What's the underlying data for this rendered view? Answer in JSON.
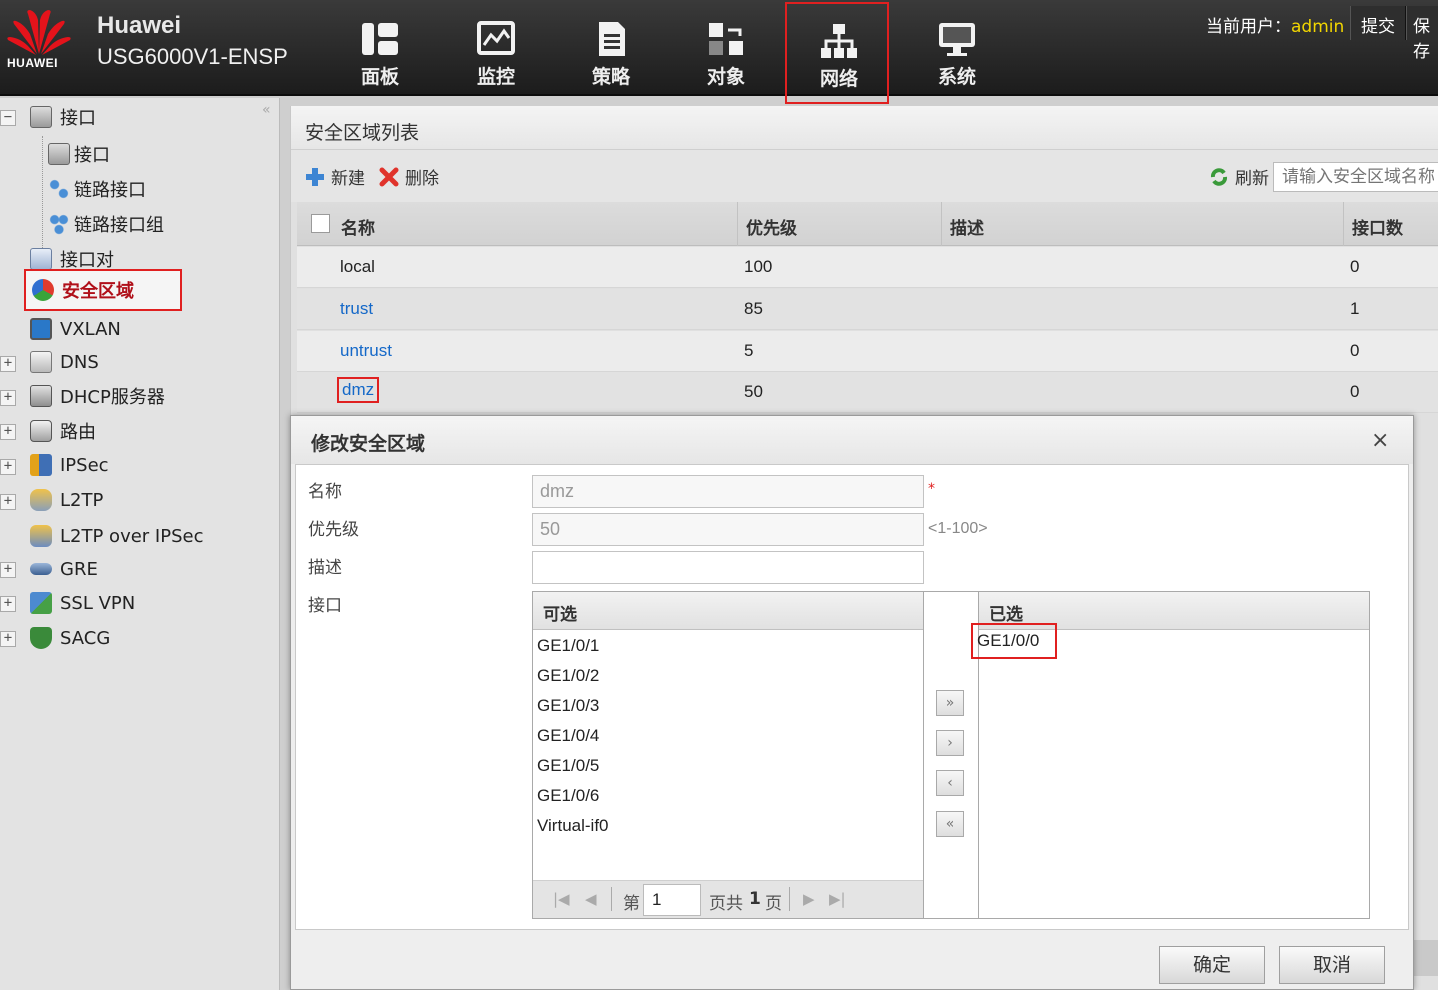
{
  "header": {
    "logo_text": "HUAWEI",
    "brand": "Huawei",
    "model": "USG6000V1-ENSP",
    "nav": [
      {
        "label": "面板",
        "icon": "dashboard-icon"
      },
      {
        "label": "监控",
        "icon": "monitor-icon"
      },
      {
        "label": "策略",
        "icon": "policy-icon"
      },
      {
        "label": "对象",
        "icon": "object-icon"
      },
      {
        "label": "网络",
        "icon": "network-icon",
        "active": true
      },
      {
        "label": "系统",
        "icon": "system-icon"
      }
    ],
    "user_label": "当前用户：",
    "user_name": "admin",
    "submit_label": "提交",
    "save_label": "保存"
  },
  "sidebar": {
    "items": [
      {
        "label": "接口",
        "expand": "−"
      },
      {
        "label": "接口"
      },
      {
        "label": "链路接口"
      },
      {
        "label": "链路接口组"
      },
      {
        "label": "接口对"
      },
      {
        "label": "安全区域",
        "selected": true
      },
      {
        "label": "VXLAN"
      },
      {
        "label": "DNS",
        "expand": "+"
      },
      {
        "label": "DHCP服务器",
        "expand": "+"
      },
      {
        "label": "路由",
        "expand": "+"
      },
      {
        "label": "IPSec",
        "expand": "+"
      },
      {
        "label": "L2TP",
        "expand": "+"
      },
      {
        "label": "L2TP over IPSec"
      },
      {
        "label": "GRE",
        "expand": "+"
      },
      {
        "label": "SSL VPN",
        "expand": "+"
      },
      {
        "label": "SACG",
        "expand": "+"
      }
    ]
  },
  "panel": {
    "title": "安全区域列表",
    "toolbar": {
      "new_label": "新建",
      "delete_label": "删除",
      "refresh_label": "刷新",
      "search_placeholder": "请输入安全区域名称"
    },
    "columns": [
      "名称",
      "优先级",
      "描述",
      "接口数"
    ],
    "rows": [
      {
        "name": "local",
        "priority": "100",
        "desc": "",
        "count": "0"
      },
      {
        "name": "trust",
        "priority": "85",
        "desc": "",
        "count": "1"
      },
      {
        "name": "untrust",
        "priority": "5",
        "desc": "",
        "count": "0"
      },
      {
        "name": "dmz",
        "priority": "50",
        "desc": "",
        "count": "0"
      }
    ]
  },
  "dialog": {
    "title": "修改安全区域",
    "close": "×",
    "fields": {
      "name_label": "名称",
      "name_value": "dmz",
      "required_mark": "*",
      "priority_label": "优先级",
      "priority_value": "50",
      "priority_hint": "<1-100>",
      "desc_label": "描述",
      "desc_value": "",
      "interface_label": "接口"
    },
    "available": {
      "title": "可选",
      "items": [
        "GE1/0/1",
        "GE1/0/2",
        "GE1/0/3",
        "GE1/0/4",
        "GE1/0/5",
        "GE1/0/6",
        "Virtual-if0"
      ]
    },
    "selected": {
      "title": "已选",
      "items": [
        "GE1/0/0"
      ]
    },
    "pager": {
      "page_prefix": "第",
      "page_value": "1",
      "page_suffix": "页共",
      "total": "1",
      "total_suffix": "页"
    },
    "move_buttons": [
      "»",
      "›",
      "‹",
      "«"
    ],
    "ok_label": "确定",
    "cancel_label": "取消"
  }
}
